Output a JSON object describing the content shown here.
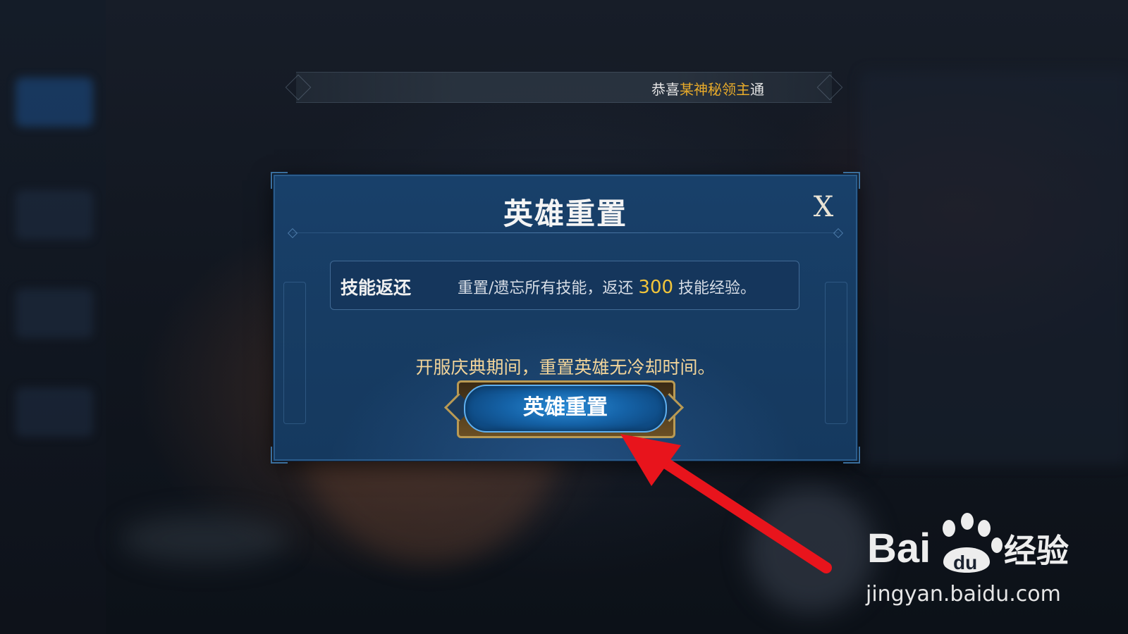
{
  "marquee": {
    "prefix": "恭喜",
    "player_name": "某神秘领主",
    "suffix": "通"
  },
  "dialog": {
    "title": "英雄重置",
    "close_label": "X",
    "skill_row": {
      "label": "技能返还",
      "desc_prefix": "重置/遗忘所有技能，返还 ",
      "amount": "300",
      "desc_suffix": " 技能经验。"
    },
    "notice": "开服庆典期间，重置英雄无冷却时间。",
    "reset_button_label": "英雄重置"
  },
  "watermark": {
    "brand_text": "Bai  经验",
    "url": "jingyan.baidu.com"
  },
  "colors": {
    "gold_text": "#e8ab2a",
    "amount": "#f2c53a",
    "notice": "#f3d59a",
    "arrow": "#e8141c",
    "dialog_bg": "#173c63",
    "button_blue": "#1563a8"
  }
}
